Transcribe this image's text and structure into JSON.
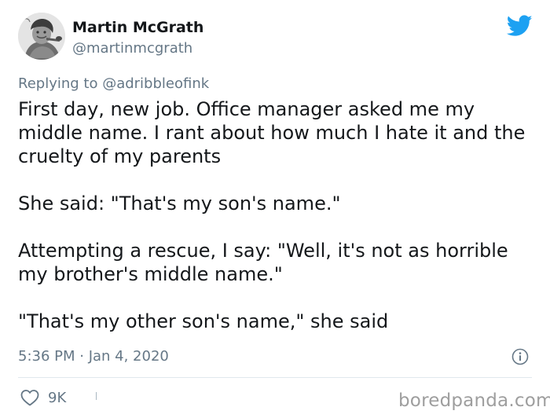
{
  "author": {
    "display_name": "Martin McGrath",
    "handle": "@martinmcgrath",
    "avatar_icon": "portrait-avatar"
  },
  "reply": {
    "prefix": "Replying to ",
    "mention": "@adribbleofink"
  },
  "body": {
    "paragraphs": [
      "First day, new job. Office manager asked me my middle name. I rant about how much I hate it and the cruelty of my parents",
      "She said: \"That's my son's name.\"",
      "Attempting a rescue, I say: \"Well, it's not as horrible my brother's middle name.\"",
      "\"That's my other son's name,\" she said"
    ]
  },
  "meta": {
    "timestamp": "5:36 PM · Jan 4, 2020",
    "info_icon": "info-icon"
  },
  "actions": {
    "like_count": "9K",
    "like_icon": "heart-icon"
  },
  "brand": {
    "logo_icon": "twitter-bird-icon",
    "logo_color": "#1da1f2",
    "watermark": "boredpanda.com"
  },
  "colors": {
    "text": "#14171a",
    "secondary": "#657786",
    "divider": "#e1e8ed"
  }
}
